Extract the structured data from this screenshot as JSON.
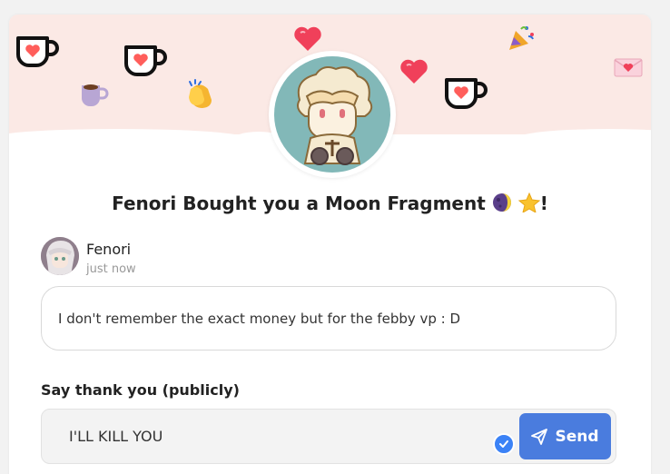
{
  "header": {
    "title_name": "Fenori",
    "title_mid": "Bought you a",
    "title_item": "Moon Fragment",
    "title_end": "!",
    "icons": [
      "kofi-cup-icon",
      "coffee-mug-icon",
      "clapping-hands-icon",
      "heart-icon",
      "party-popper-icon",
      "love-letter-icon",
      "moon-icon",
      "star-icon"
    ]
  },
  "message": {
    "sender": "Fenori",
    "time": "just now",
    "text": "I don't remember the exact money but for the febby vp : D"
  },
  "reply": {
    "label": "Say thank you (publicly)",
    "value": "I'LL KILL YOU",
    "send_label": "Send"
  },
  "colors": {
    "banner": "#fbe9e5",
    "accent": "#4a7cde",
    "kofi_red": "#ff5e5b",
    "avatar_bg": "#82b8b8"
  }
}
